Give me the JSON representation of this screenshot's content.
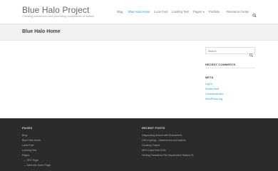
{
  "site": {
    "title": "Blue Halo Project",
    "tagline": "Creating awareness and promoting acceptance of autism"
  },
  "nav": {
    "items": [
      {
        "label": "Blog"
      },
      {
        "label": "Blue Halo Home"
      },
      {
        "label": "Lucis Fact"
      },
      {
        "label": "Landing Test"
      },
      {
        "label": "Pages"
      },
      {
        "label": "Portfolio"
      },
      {
        "label": "Resource Center"
      }
    ],
    "active_index": 1,
    "search_icon": "search-icon"
  },
  "page": {
    "title": "Blue Halo Home"
  },
  "sidebar": {
    "search": {
      "placeholder": "Search",
      "icon": "search-icon"
    },
    "recent_comments": {
      "heading": "RECENT COMMENTS"
    },
    "meta": {
      "heading": "META",
      "links": [
        "Log in",
        "Entries feed",
        "Comments feed",
        "WordPress.org"
      ]
    }
  },
  "footer": {
    "pages": {
      "heading": "PAGES",
      "links": [
        "Blog",
        "Blue Halo Home",
        "Lucis Fact",
        "Landing Test",
        "Pages",
        "— SFX Page",
        "— Meet the Team Page"
      ]
    },
    "recent_posts": {
      "heading": "RECENT POSTS",
      "links": [
        "Diagnosing Autism with Biomarkers",
        "Gift of giving – Waterworks and adieux",
        "Housing Project",
        "WHI Cuba Fest 2016",
        "Visiting Pasadena Fire Department Station 91"
      ]
    }
  },
  "colors": {
    "accent": "#1e9bd6",
    "footer_bg": "#2b2b2b",
    "title_band_bg": "#f1f1f1"
  }
}
